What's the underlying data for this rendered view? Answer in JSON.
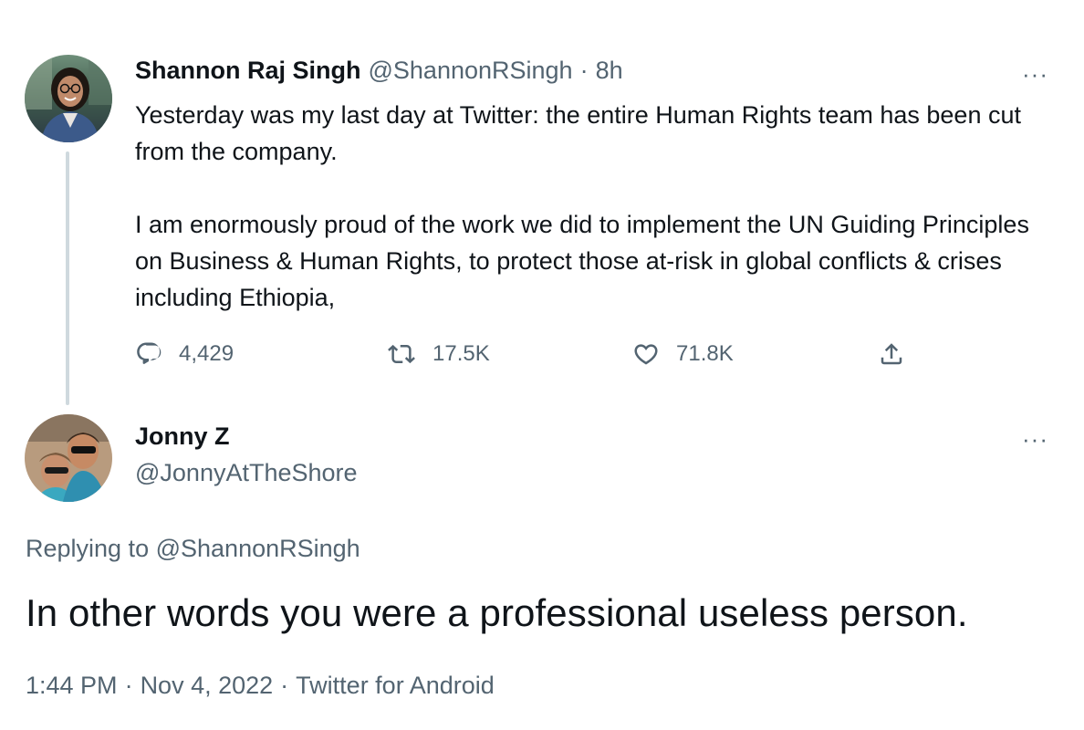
{
  "original_tweet": {
    "author_name": "Shannon Raj Singh",
    "author_handle": "@ShannonRSingh",
    "separator": "·",
    "time_ago": "8h",
    "more_label": "···",
    "paragraphs": [
      "Yesterday was my last day at Twitter: the entire Human Rights team has been cut from the company.",
      "I am enormously proud of the work we did to implement the UN Guiding Principles on Business & Human Rights, to protect those at-risk in global conflicts & crises including Ethiopia,"
    ],
    "actions": {
      "replies": {
        "icon": "reply-icon",
        "count": "4,429"
      },
      "retweets": {
        "icon": "retweet-icon",
        "count": "17.5K"
      },
      "likes": {
        "icon": "heart-icon",
        "count": "71.8K"
      },
      "share": {
        "icon": "share-icon"
      }
    }
  },
  "reply_tweet": {
    "author_name": "Jonny Z",
    "author_handle": "@JonnyAtTheShore",
    "more_label": "···",
    "replying_prefix": "Replying to",
    "replying_to": "@ShannonRSingh",
    "text": "In other words you were a professional useless person.",
    "time": "1:44 PM",
    "separator": "·",
    "date": "Nov 4, 2022",
    "source": "Twitter for Android"
  },
  "colors": {
    "text_primary": "#0f1419",
    "text_secondary": "#536471",
    "thread_line": "#cfd9de"
  }
}
